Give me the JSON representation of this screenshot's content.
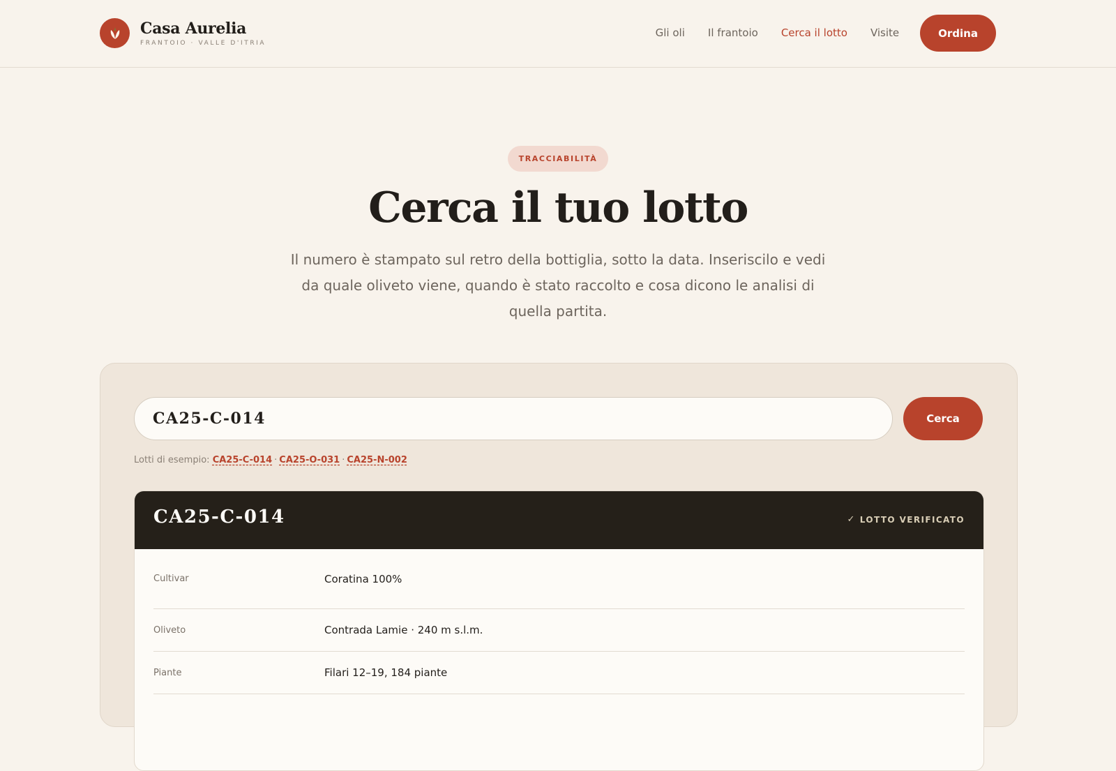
{
  "brand": {
    "name": "Casa Aurelia",
    "tagline": "FRANTOIO · VALLE D'ITRIA",
    "logo_color": "#b8432c"
  },
  "nav": {
    "items": [
      {
        "label": "Gli oli"
      },
      {
        "label": "Il frantoio"
      },
      {
        "label": "Cerca il lotto",
        "active": true
      },
      {
        "label": "Visite"
      }
    ],
    "order_label": "Ordina"
  },
  "hero": {
    "badge": "TRACCIABILITÀ",
    "title": "Cerca il tuo lotto",
    "subtitle": "Il numero è stampato sul retro della bottiglia, sotto la data. Inseriscilo e vedi da quale oliveto viene, quando è stato raccolto e cosa dicono le analisi di quella partita."
  },
  "search": {
    "value": "CA25-C-014",
    "button_label": "Cerca",
    "examples_label": "Lotti di esempio:",
    "examples": [
      "CA25-C-014",
      "CA25-O-031",
      "CA25-N-002"
    ]
  },
  "result": {
    "code": "CA25-C-014",
    "status": "LOTTO VERIFICATO",
    "rows": [
      {
        "label": "Cultivar",
        "value": "Coratina 100%"
      },
      {
        "label": "Oliveto",
        "value": "Contrada Lamie · 240 m s.l.m."
      },
      {
        "label": "Piante",
        "value": "Filari 12–19, 184 piante"
      }
    ]
  },
  "colors": {
    "accent": "#b8432c",
    "background": "#f8f3ec",
    "panel": "#efe6db",
    "dark": "#252019"
  }
}
